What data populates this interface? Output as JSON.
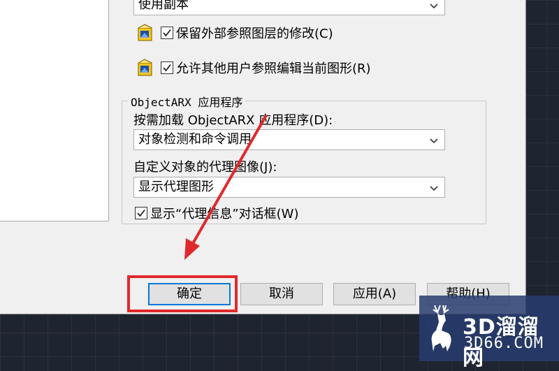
{
  "dialog": {
    "xref_copy_combo": {
      "value": "使用副本"
    },
    "xref_options": [
      {
        "label": "保留外部参照图层的修改(C)",
        "checked": true
      },
      {
        "label": "允许其他用户参照编辑当前图形(R)",
        "checked": true
      }
    ],
    "objectarx": {
      "group_title": "ObjectARX 应用程序",
      "demand_load_label": "按需加载 ObjectARX 应用程序(D):",
      "demand_load_value": "对象检测和命令调用",
      "proxy_image_label": "自定义对象的代理图像(J):",
      "proxy_image_value": "显示代理图形",
      "proxy_info_label": "显示“代理信息”对话框(W)",
      "proxy_info_checked": true
    },
    "buttons": {
      "ok": "确定",
      "cancel": "取消",
      "apply": "应用(A)",
      "help": "帮助(H)"
    }
  },
  "annotation": {
    "color": "#e0292c"
  },
  "watermark": {
    "brand": "3D溜溜网",
    "url": "3D66.COM"
  }
}
